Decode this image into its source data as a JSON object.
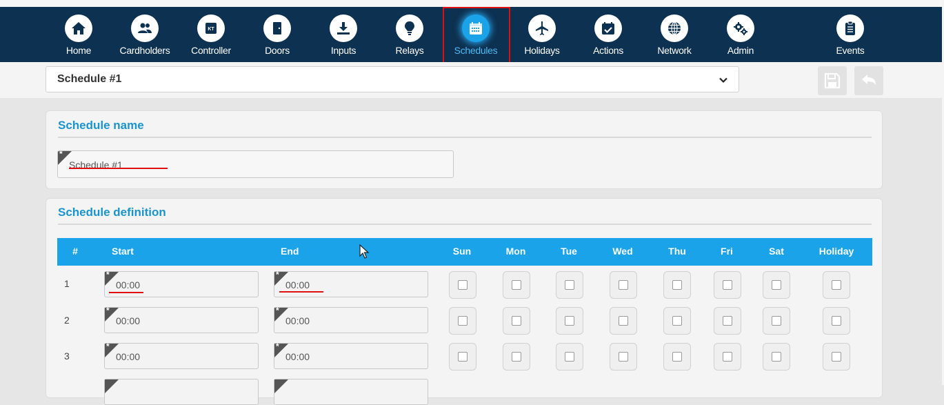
{
  "nav": {
    "items": [
      {
        "label": "Home",
        "icon": "home-icon"
      },
      {
        "label": "Cardholders",
        "icon": "users-icon"
      },
      {
        "label": "Controller",
        "icon": "controller-icon",
        "icon_text": "KT"
      },
      {
        "label": "Doors",
        "icon": "door-icon"
      },
      {
        "label": "Inputs",
        "icon": "input-icon"
      },
      {
        "label": "Relays",
        "icon": "lightbulb-icon"
      },
      {
        "label": "Schedules",
        "icon": "calendar-icon",
        "active": true
      },
      {
        "label": "Holidays",
        "icon": "airplane-icon"
      },
      {
        "label": "Actions",
        "icon": "calendar-check-icon"
      },
      {
        "label": "Network",
        "icon": "globe-icon"
      },
      {
        "label": "Admin",
        "icon": "gears-icon"
      },
      {
        "label": "Events",
        "icon": "clipboard-icon"
      }
    ]
  },
  "selector": {
    "value": "Schedule #1"
  },
  "name_card": {
    "title": "Schedule name",
    "value": "Schedule #1"
  },
  "definition": {
    "title": "Schedule definition",
    "columns": [
      "#",
      "Start",
      "End",
      "Sun",
      "Mon",
      "Tue",
      "Wed",
      "Thu",
      "Fri",
      "Sat",
      "Holiday"
    ],
    "rows": [
      {
        "num": "1",
        "start": "00:00",
        "end": "00:00",
        "days": [
          false,
          false,
          false,
          false,
          false,
          false,
          false,
          false
        ]
      },
      {
        "num": "2",
        "start": "00:00",
        "end": "00:00",
        "days": [
          false,
          false,
          false,
          false,
          false,
          false,
          false,
          false
        ]
      },
      {
        "num": "3",
        "start": "00:00",
        "end": "00:00",
        "days": [
          false,
          false,
          false,
          false,
          false,
          false,
          false,
          false
        ]
      }
    ]
  },
  "colors": {
    "navbar": "#0d3150",
    "accent": "#1aa3e8",
    "title": "#1a94cf",
    "annotation": "#e01010"
  }
}
